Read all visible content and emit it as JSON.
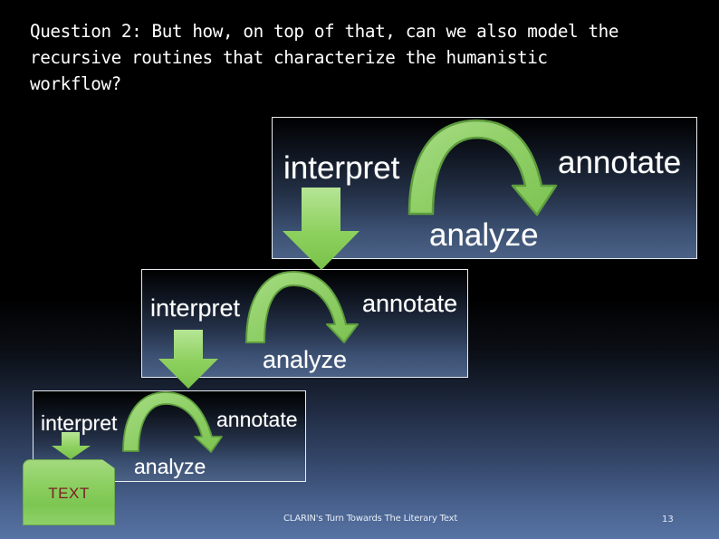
{
  "slide": {
    "question": "Question 2: But how, on top of that, can we also model the\nrecursive routines that characterize the humanistic\nworkflow?",
    "colors": {
      "arrow_green": "#8fd464",
      "arrow_green_dark": "#5e9c3e",
      "text_box_label": "#7a1d22",
      "panel_border": "#e8ecf0",
      "background_bottom": "#5673a3"
    },
    "panels": [
      {
        "interpret": "interpret",
        "annotate": "annotate",
        "analyze": "analyze"
      },
      {
        "interpret": "interpret",
        "annotate": "annotate",
        "analyze": "analyze"
      },
      {
        "interpret": "interpret",
        "annotate": "annotate",
        "analyze": "analyze"
      }
    ],
    "text_box": {
      "label": "TEXT"
    },
    "footer": {
      "title": "CLARIN's Turn Towards The Literary Text",
      "page_number": "13"
    }
  }
}
